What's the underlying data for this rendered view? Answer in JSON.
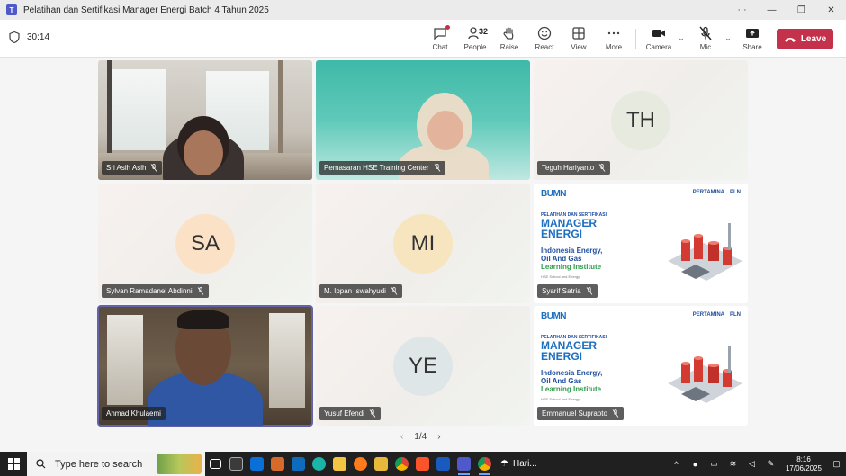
{
  "window": {
    "title": "Pelatihan dan Sertifikasi Manager Energi Batch 4 Tahun 2025",
    "icon": "teams-icon"
  },
  "meeting": {
    "timer": "30:14",
    "toolbar": {
      "chat": "Chat",
      "people": "People",
      "people_count": "32",
      "raise": "Raise",
      "react": "React",
      "view": "View",
      "more": "More",
      "camera": "Camera",
      "mic": "Mic",
      "share": "Share",
      "leave": "Leave"
    }
  },
  "participants": [
    {
      "name": "Sri Asih Asih",
      "type": "video",
      "muted": true
    },
    {
      "name": "Pemasaran HSE Training Center",
      "type": "video",
      "muted": true
    },
    {
      "name": "Teguh Hariyanto",
      "type": "avatar",
      "initials": "TH",
      "avatar_color": "#e6eadf",
      "muted": true
    },
    {
      "name": "Sylvan Ramadanel Abdinni",
      "type": "avatar",
      "initials": "SA",
      "avatar_color": "#fbe2c6",
      "muted": true
    },
    {
      "name": "M. Ippan Iswahyudi",
      "type": "avatar",
      "initials": "MI",
      "avatar_color": "#f7e5bf",
      "muted": true
    },
    {
      "name": "Syarif Satria",
      "type": "slide",
      "muted": true
    },
    {
      "name": "Ahmad Khulaemi",
      "type": "video",
      "muted": false,
      "active_speaker": true
    },
    {
      "name": "Yusuf Efendi",
      "type": "avatar",
      "initials": "YE",
      "avatar_color": "#dfe6e8",
      "muted": true
    },
    {
      "name": "Emmanuel Suprapto",
      "type": "slide",
      "muted": true
    }
  ],
  "slide": {
    "bumn": "BUMN",
    "partners": [
      "PERTAMINA",
      "PLN"
    ],
    "heading_small": "PELATIHAN DAN SERTIFIKASI",
    "heading_line1": "MANAGER",
    "heading_line2": "ENERGI",
    "institute_line1": "Indonesia Energy,",
    "institute_line2": "Oil And Gas",
    "institute_line3": "Learning Institute",
    "tagline": "HSE School and Energy"
  },
  "pager": {
    "text": "1/4"
  },
  "taskbar": {
    "search_placeholder": "Type here to search",
    "weather_text": "Hari...",
    "time": "8:16",
    "date": "17/06/2025",
    "apps": [
      "task-view",
      "media",
      "store",
      "photos",
      "outlook",
      "edge",
      "explorer",
      "firefox",
      "files",
      "chrome",
      "brave",
      "word",
      "teams",
      "chrome-2"
    ]
  }
}
